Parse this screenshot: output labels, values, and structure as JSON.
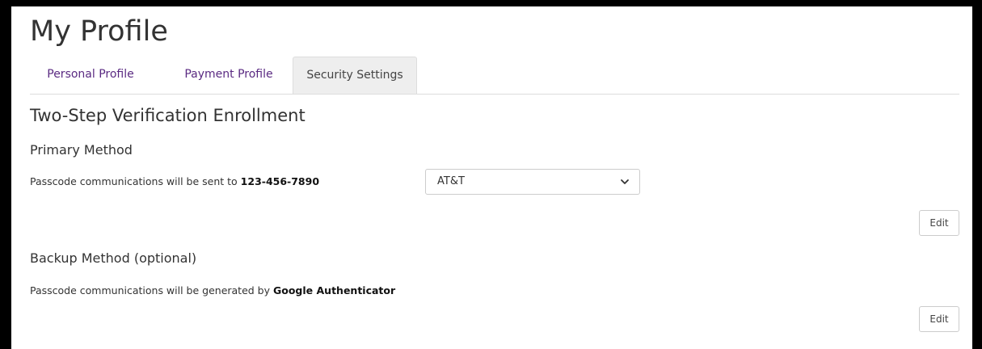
{
  "page": {
    "title": "My Profile"
  },
  "tabs": [
    {
      "label": "Personal Profile",
      "active": false
    },
    {
      "label": "Payment Profile",
      "active": false
    },
    {
      "label": "Security Settings",
      "active": true
    }
  ],
  "section": {
    "title": "Two-Step Verification Enrollment"
  },
  "primary": {
    "heading": "Primary Method",
    "desc_prefix": "Passcode communications will be sent to ",
    "phone": "123-456-7890",
    "carrier_selected": "AT&T",
    "edit_label": "Edit"
  },
  "backup": {
    "heading": "Backup Method (optional)",
    "desc_prefix": "Passcode communications will be generated by ",
    "app": "Google Authenticator",
    "edit_label": "Edit"
  },
  "colors": {
    "tab_link": "#5a2a82",
    "active_tab_bg": "#eeeeee",
    "text": "#333333"
  },
  "icons": {
    "select_chevron": "chevron-down-icon"
  }
}
